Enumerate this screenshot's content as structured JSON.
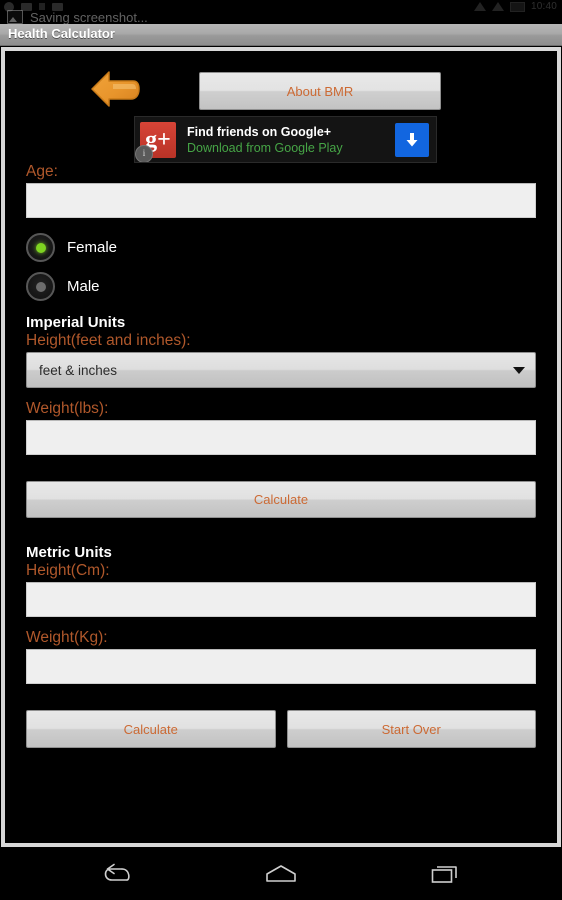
{
  "status_bar": {
    "time": "10:40",
    "notification_text": "Saving screenshot...",
    "notification_icon": "image-icon",
    "left_icons": [
      "app-icon",
      "screenshot-icon",
      "dot-icon",
      "app-icon-2"
    ],
    "right_icons": [
      "signal-icon",
      "wifi-icon",
      "battery-icon"
    ]
  },
  "window": {
    "title": "Health Calculator"
  },
  "header": {
    "back_icon": "back-arrow-icon",
    "about_button": "About BMR"
  },
  "ad": {
    "brand_glyph": "g+",
    "info_badge": "i",
    "headline": "Find friends on Google+",
    "subline": "Download from Google Play",
    "download_icon": "download-arrow-icon",
    "brand_color": "#d74437",
    "link_color": "#46a546",
    "download_color": "#1266e0"
  },
  "form": {
    "age_label": "Age:",
    "age_value": "",
    "age_placeholder": "",
    "gender": {
      "female_label": "Female",
      "female_selected": true,
      "male_label": "Male",
      "male_selected": false,
      "selected_color": "#7ed321"
    },
    "imperial": {
      "section_label": "Imperial Units",
      "height_label": "Height(feet and inches):",
      "height_spinner_value": "feet & inches",
      "height_spinner_options": [
        "feet & inches"
      ],
      "weight_label": "Weight(lbs):",
      "weight_value": "",
      "weight_placeholder": "",
      "calculate_button": "Calculate"
    },
    "metric": {
      "section_label": "Metric Units",
      "height_label": "Height(Cm):",
      "height_value": "",
      "height_placeholder": "",
      "weight_label": "Weight(Kg):",
      "weight_value": "",
      "weight_placeholder": "",
      "calculate_button": "Calculate",
      "start_over_button": "Start Over"
    },
    "label_color": "#b0582b",
    "button_text_color": "#cc6a34"
  },
  "nav_bar": {
    "back_icon": "back-nav-icon",
    "home_icon": "home-nav-icon",
    "recents_icon": "recents-nav-icon"
  }
}
